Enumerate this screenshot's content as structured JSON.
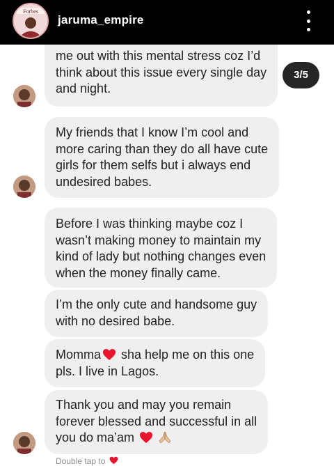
{
  "header": {
    "account_name": "jaruma_empire",
    "avatar_label": "Forbes"
  },
  "story": {
    "page_indicator": "3/5"
  },
  "messages": [
    {
      "lines": [
        "me out with this mental stress coz I’d",
        "think about this issue every single day",
        "and night."
      ]
    },
    {
      "lines": [
        "My friends that I know I’m cool and",
        "more caring than they do all have cute",
        "girls for them selfs but i always end",
        "undesired babes."
      ]
    },
    {
      "lines": [
        "Before I was thinking maybe coz I",
        "wasn’t making money to maintain my",
        "kind of lady but nothing changes even",
        "when the money finally came."
      ]
    },
    {
      "lines": [
        "I’m the only cute and handsome guy",
        "with no desired babe."
      ]
    },
    {
      "line1_before_emoji": "Momma",
      "line1_after_emoji": " sha help me on this one",
      "line2": "pls. I live in Lagos."
    },
    {
      "line1": "Thank you and may you remain",
      "line2": "forever blessed and successful in all",
      "line3_text": "you do ma’am "
    }
  ],
  "emoji": {
    "heart": "red-heart",
    "hands": "folded-hands"
  },
  "footer": {
    "hint": "Double tap to"
  },
  "colors": {
    "header_bg": "#000000",
    "bubble_bg": "#efefef",
    "text": "#222222",
    "heart": "#e8132d",
    "indicator_bg": "#262626"
  }
}
